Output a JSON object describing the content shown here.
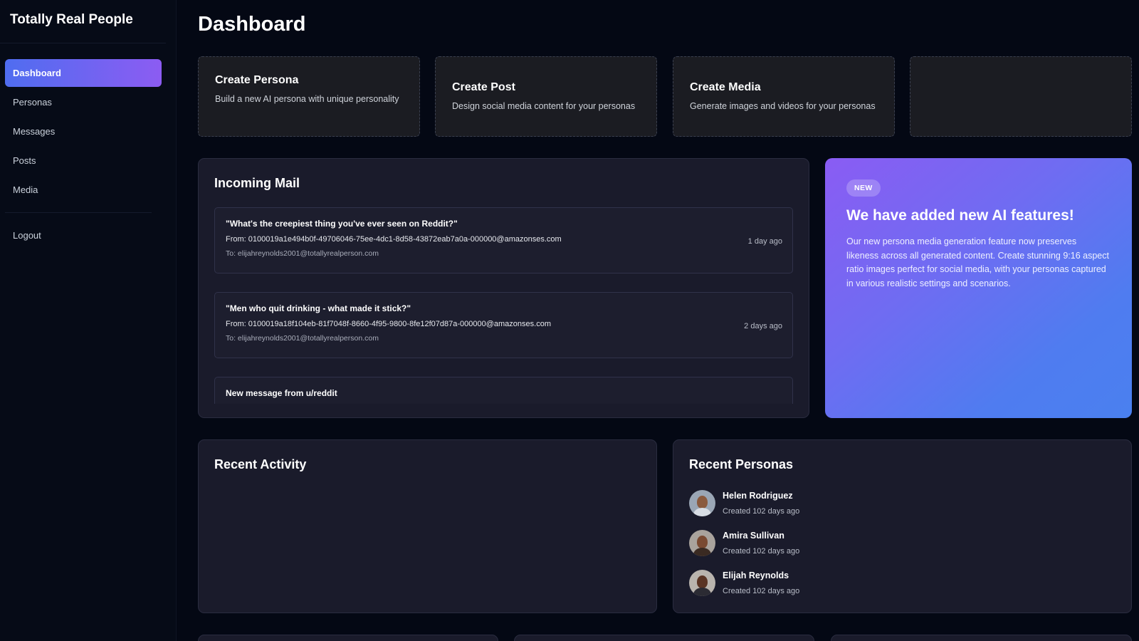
{
  "app": {
    "title": "Totally Real People"
  },
  "sidebar": {
    "items": [
      {
        "label": "Dashboard"
      },
      {
        "label": "Personas"
      },
      {
        "label": "Messages"
      },
      {
        "label": "Posts"
      },
      {
        "label": "Media"
      }
    ],
    "logout": "Logout"
  },
  "page": {
    "title": "Dashboard"
  },
  "actions": [
    {
      "title": "Create Persona",
      "description": "Build a new AI persona with unique personality"
    },
    {
      "title": "Create Post",
      "description": "Design social media content for your personas"
    },
    {
      "title": "Create Media",
      "description": "Generate images and videos for your personas"
    }
  ],
  "mail": {
    "title": "Incoming Mail",
    "items": [
      {
        "subject": "\"What's the creepiest thing you've ever seen on Reddit?\"",
        "from": "From: 0100019a1e494b0f-49706046-75ee-4dc1-8d58-43872eab7a0a-000000@amazonses.com",
        "to": "To: elijahreynolds2001@totallyrealperson.com",
        "time": "1 day ago"
      },
      {
        "subject": "\"Men who quit drinking - what made it stick?\"",
        "from": "From: 0100019a18f104eb-81f7048f-8660-4f95-9800-8fe12f07d87a-000000@amazonses.com",
        "to": "To: elijahreynolds2001@totallyrealperson.com",
        "time": "2 days ago"
      },
      {
        "subject": "New message from u/reddit"
      }
    ]
  },
  "promo": {
    "badge": "NEW",
    "title": "We have added new AI features!",
    "text": "Our new persona media generation feature now preserves likeness across all generated content. Create stunning 9:16 aspect ratio images perfect for social media, with your personas captured in various realistic settings and scenarios."
  },
  "activity": {
    "title": "Recent Activity"
  },
  "personas": {
    "title": "Recent Personas",
    "items": [
      {
        "name": "Helen Rodriguez",
        "created": "Created 102 days ago"
      },
      {
        "name": "Amira Sullivan",
        "created": "Created 102 days ago"
      },
      {
        "name": "Elijah Reynolds",
        "created": "Created 102 days ago"
      }
    ]
  },
  "colors": {
    "background": "#040814",
    "accent_start": "#4f6df0",
    "accent_end": "#8c5cf2",
    "panel": "#1a1b2b"
  }
}
